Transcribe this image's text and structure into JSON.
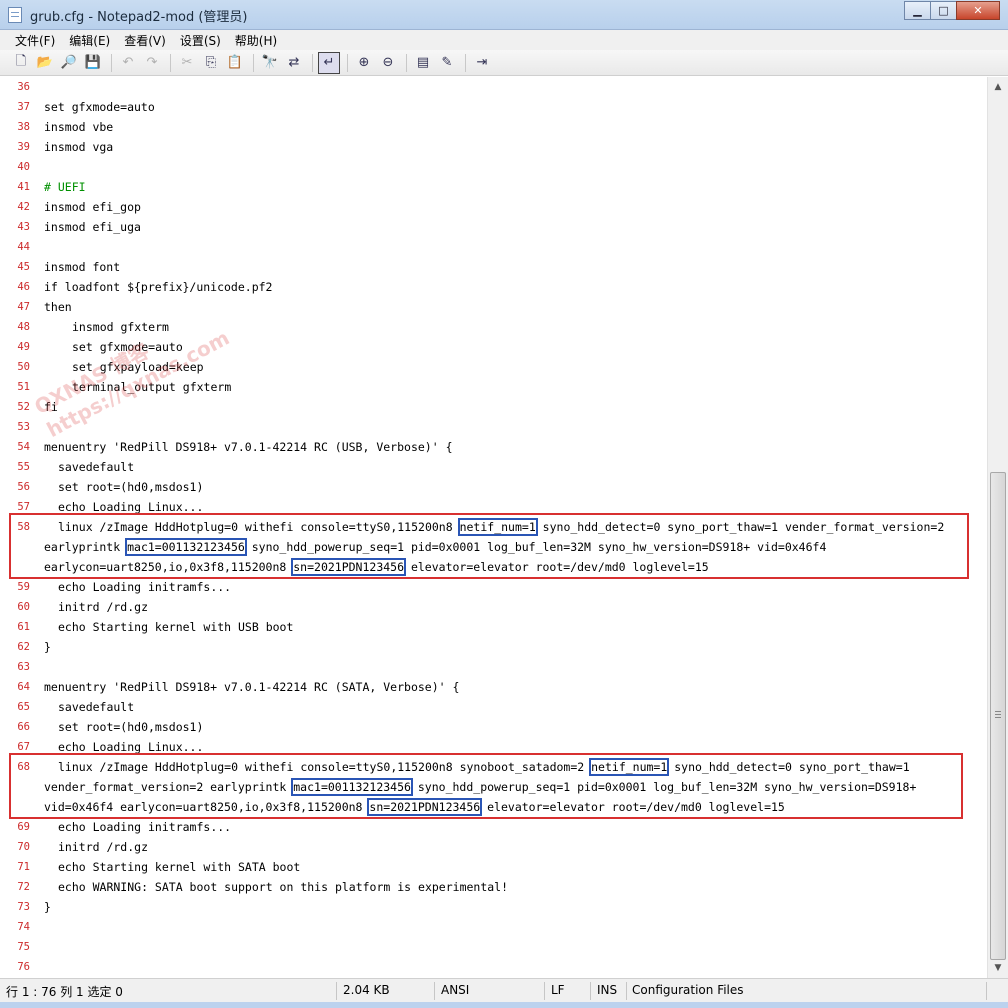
{
  "window": {
    "title": "grub.cfg - Notepad2-mod (管理员)",
    "minimize": "▁",
    "maximize": "□",
    "close": "✕"
  },
  "menu": [
    "文件(F)",
    "编辑(E)",
    "查看(V)",
    "设置(S)",
    "帮助(H)"
  ],
  "toolbar": {
    "icons": [
      "new-file-icon",
      "open-folder-icon",
      "browse-icon",
      "save-icon",
      "undo-icon",
      "redo-icon",
      "cut-icon",
      "copy-icon",
      "paste-icon",
      "find-icon",
      "replace-icon",
      "word-wrap-icon",
      "zoom-in-icon",
      "zoom-out-icon",
      "scheme-icon",
      "customize-icon",
      "exit-icon"
    ]
  },
  "editor": {
    "lines": [
      {
        "n": "36",
        "text": ""
      },
      {
        "n": "37",
        "text": "set gfxmode=auto"
      },
      {
        "n": "38",
        "text": "insmod vbe"
      },
      {
        "n": "39",
        "text": "insmod vga"
      },
      {
        "n": "40",
        "text": ""
      },
      {
        "n": "41",
        "text": "# UEFI"
      },
      {
        "n": "42",
        "text": "insmod efi_gop"
      },
      {
        "n": "43",
        "text": "insmod efi_uga"
      },
      {
        "n": "44",
        "text": ""
      },
      {
        "n": "45",
        "text": "insmod font"
      },
      {
        "n": "46",
        "text": "if loadfont ${prefix}/unicode.pf2"
      },
      {
        "n": "47",
        "text": "then"
      },
      {
        "n": "48",
        "text": "insmod gfxterm"
      },
      {
        "n": "49",
        "text": "set gfxmode=auto"
      },
      {
        "n": "50",
        "text": "set gfxpayload=keep"
      },
      {
        "n": "51",
        "text": "terminal_output gfxterm"
      },
      {
        "n": "52",
        "text": "fi"
      },
      {
        "n": "53",
        "text": ""
      },
      {
        "n": "54",
        "text": "menuentry 'RedPill DS918+ v7.0.1-42214 RC (USB, Verbose)' {"
      },
      {
        "n": "55",
        "text": "savedefault"
      },
      {
        "n": "56",
        "text": "set root=(hd0,msdos1)"
      },
      {
        "n": "57",
        "text": "echo Loading Linux..."
      },
      {
        "n": "59",
        "text": "echo Loading initramfs..."
      },
      {
        "n": "60",
        "text": "initrd /rd.gz"
      },
      {
        "n": "61",
        "text": "echo Starting kernel with USB boot"
      },
      {
        "n": "62",
        "text": "}"
      },
      {
        "n": "63",
        "text": ""
      },
      {
        "n": "64",
        "text": "menuentry 'RedPill DS918+ v7.0.1-42214 RC (SATA, Verbose)' {"
      },
      {
        "n": "65",
        "text": "savedefault"
      },
      {
        "n": "66",
        "text": "set root=(hd0,msdos1)"
      },
      {
        "n": "67",
        "text": "echo Loading Linux..."
      },
      {
        "n": "69",
        "text": "echo Loading initramfs..."
      },
      {
        "n": "70",
        "text": "initrd /rd.gz"
      },
      {
        "n": "71",
        "text": "echo Starting kernel with SATA boot"
      },
      {
        "n": "72",
        "text": "echo WARNING: SATA boot support on this platform is experimental!"
      },
      {
        "n": "73",
        "text": "}"
      },
      {
        "n": "74",
        "text": ""
      },
      {
        "n": "75",
        "text": ""
      },
      {
        "n": "76",
        "text": ""
      }
    ],
    "line58": {
      "n": "58",
      "a1": "linux /zImage HddHotplug=0 withefi console=ttyS0,115200n8 ",
      "b1": "netif_num=1",
      "c1": " syno_hdd_detect=0 syno_port_thaw=1 vender_format_version=2",
      "a2": "earlyprintk ",
      "b2": "mac1=001132123456",
      "c2": " syno_hdd_powerup_seq=1 pid=0x0001 log_buf_len=32M syno_hw_version=DS918+ vid=0x46f4",
      "a3": "earlycon=uart8250,io,0x3f8,115200n8 ",
      "b3": "sn=2021PDN123456",
      "c3": " elevator=elevator root=/dev/md0 loglevel=15"
    },
    "line68": {
      "n": "68",
      "a1": "linux /zImage HddHotplug=0 withefi console=ttyS0,115200n8 synoboot_satadom=2 ",
      "b1": "netif_num=1",
      "c1": " syno_hdd_detect=0 syno_port_thaw=1",
      "a2": "vender_format_version=2 earlyprintk ",
      "b2": "mac1=001132123456",
      "c2": " syno_hdd_powerup_seq=1 pid=0x0001 log_buf_len=32M syno_hw_version=DS918+",
      "a3": "vid=0x46f4 earlycon=uart8250,io,0x3f8,115200n8 ",
      "b3": "sn=2021PDN123456",
      "c3": " elevator=elevator root=/dev/md0 loglevel=15"
    },
    "watermark": [
      "QXNAS 博客",
      "https://qxnas.com"
    ]
  },
  "statusbar": {
    "position": "行 1 : 76   列 1   选定 0",
    "size": "2.04 KB",
    "encoding": "ANSI",
    "eol": "LF",
    "mode": "INS",
    "scheme": "Configuration Files"
  },
  "colors": {
    "line_number": "#cc2a2a",
    "comment": "#009000",
    "highlight_red": "#d83030",
    "highlight_blue": "#2a55b5"
  }
}
